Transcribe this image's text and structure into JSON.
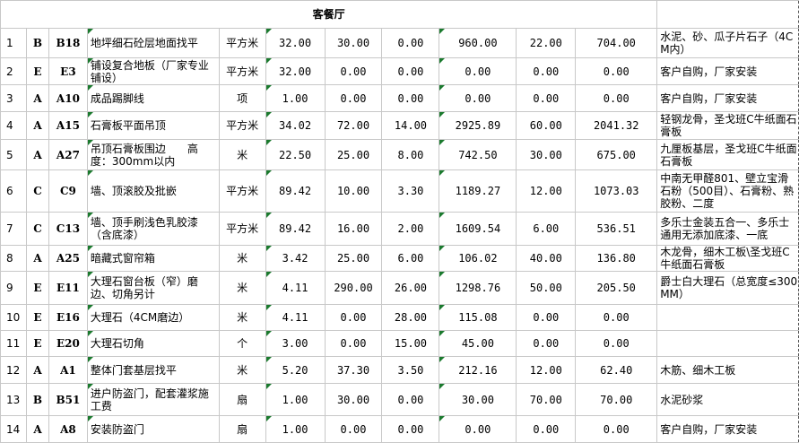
{
  "sheet": {
    "title": "客餐厅",
    "rows": [
      {
        "no": "1",
        "cls": "B",
        "code": "B18",
        "name": "地坪细石砼层地面找平",
        "unit": "平方米",
        "qty": "32.00",
        "mat": "30.00",
        "lab": "0.00",
        "total": "960.00",
        "rate": "22.00",
        "amount": "704.00",
        "note": "水泥、砂、瓜子片石子（4CM内）"
      },
      {
        "no": "2",
        "cls": "E",
        "code": "E3",
        "name": "铺设复合地板（厂家专业铺设）",
        "unit": "平方米",
        "qty": "32.00",
        "mat": "0.00",
        "lab": "0.00",
        "total": "0.00",
        "rate": "0.00",
        "amount": "0.00",
        "note": "客户自购，厂家安装"
      },
      {
        "no": "3",
        "cls": "A",
        "code": "A10",
        "name": "成品踢脚线",
        "unit": "项",
        "qty": "1.00",
        "mat": "0.00",
        "lab": "0.00",
        "total": "0.00",
        "rate": "0.00",
        "amount": "0.00",
        "note": "客户自购，厂家安装"
      },
      {
        "no": "4",
        "cls": "A",
        "code": "A15",
        "name": "石膏板平面吊顶",
        "unit": "平方米",
        "qty": "34.02",
        "mat": "72.00",
        "lab": "14.00",
        "total": "2925.89",
        "rate": "60.00",
        "amount": "2041.32",
        "note": "轻钢龙骨，圣戈班C牛纸面石膏板"
      },
      {
        "no": "5",
        "cls": "A",
        "code": "A27",
        "name": "吊顶石膏板围边　　高度：300mm以内",
        "unit": "米",
        "qty": "22.50",
        "mat": "25.00",
        "lab": "8.00",
        "total": "742.50",
        "rate": "30.00",
        "amount": "675.00",
        "note": "九厘板基层，圣戈班C牛纸面石膏板"
      },
      {
        "no": "6",
        "cls": "C",
        "code": "C9",
        "name": "墙、顶滚胶及批嵌",
        "unit": "平方米",
        "qty": "89.42",
        "mat": "10.00",
        "lab": "3.30",
        "total": "1189.27",
        "rate": "12.00",
        "amount": "1073.03",
        "note": "中南无甲醛801、壁立宝滑石粉（500目）、石膏粉、熟胶粉、二度"
      },
      {
        "no": "7",
        "cls": "C",
        "code": "C13",
        "name": "墙、顶手刷浅色乳胶漆（含底漆）",
        "unit": "平方米",
        "qty": "89.42",
        "mat": "16.00",
        "lab": "2.00",
        "total": "1609.54",
        "rate": "6.00",
        "amount": "536.51",
        "note": "多乐士金装五合一、多乐士通用无添加底漆、一底"
      },
      {
        "no": "8",
        "cls": "A",
        "code": "A25",
        "name": "暗藏式窗帘箱",
        "unit": "米",
        "qty": "3.42",
        "mat": "25.00",
        "lab": "6.00",
        "total": "106.02",
        "rate": "40.00",
        "amount": "136.80",
        "note": "木龙骨，细木工板\\圣戈班C牛纸面石膏板"
      },
      {
        "no": "9",
        "cls": "E",
        "code": "E11",
        "name": "大理石窗台板（窄）磨边、切角另计",
        "unit": "米",
        "qty": "4.11",
        "mat": "290.00",
        "lab": "26.00",
        "total": "1298.76",
        "rate": "50.00",
        "amount": "205.50",
        "note": "爵士白大理石（总宽度≤300MM）"
      },
      {
        "no": "10",
        "cls": "E",
        "code": "E16",
        "name": "大理石（4CM磨边）",
        "unit": "米",
        "qty": "4.11",
        "mat": "0.00",
        "lab": "28.00",
        "total": "115.08",
        "rate": "0.00",
        "amount": "0.00",
        "note": ""
      },
      {
        "no": "11",
        "cls": "E",
        "code": "E20",
        "name": "大理石切角",
        "unit": "个",
        "qty": "3.00",
        "mat": "0.00",
        "lab": "15.00",
        "total": "45.00",
        "rate": "0.00",
        "amount": "0.00",
        "note": ""
      },
      {
        "no": "12",
        "cls": "A",
        "code": "A1",
        "name": "整体门套基层找平",
        "unit": "米",
        "qty": "5.20",
        "mat": "37.30",
        "lab": "3.50",
        "total": "212.16",
        "rate": "12.00",
        "amount": "62.40",
        "note": "木筋、细木工板"
      },
      {
        "no": "13",
        "cls": "B",
        "code": "B51",
        "name": "进户防盗门，配套灌浆施工费",
        "unit": "扇",
        "qty": "1.00",
        "mat": "30.00",
        "lab": "0.00",
        "total": "30.00",
        "rate": "70.00",
        "amount": "70.00",
        "note": "水泥砂浆"
      },
      {
        "no": "14",
        "cls": "A",
        "code": "A8",
        "name": "安装防盗门",
        "unit": "扇",
        "qty": "1.00",
        "mat": "0.00",
        "lab": "0.00",
        "total": "0.00",
        "rate": "0.00",
        "amount": "0.00",
        "note": "客户自购，厂家安装"
      }
    ]
  }
}
